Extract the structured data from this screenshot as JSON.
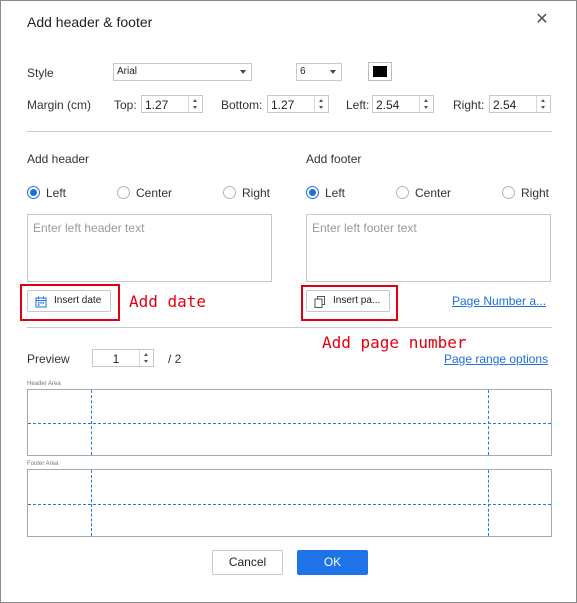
{
  "dialog": {
    "title": "Add header & footer"
  },
  "style": {
    "label": "Style",
    "font": "Arial",
    "size": "6",
    "color": "#000000"
  },
  "margin": {
    "label": "Margin (cm)",
    "top_label": "Top:",
    "top": "1.27",
    "bottom_label": "Bottom:",
    "bottom": "1.27",
    "left_label": "Left:",
    "left": "2.54",
    "right_label": "Right:",
    "right": "2.54"
  },
  "header": {
    "title": "Add header",
    "positions": [
      "Left",
      "Center",
      "Right"
    ],
    "selected": "Left",
    "placeholder": "Enter left header text",
    "insert_button": "Insert date",
    "annotation": "Add date"
  },
  "footer": {
    "title": "Add footer",
    "positions": [
      "Left",
      "Center",
      "Right"
    ],
    "selected": "Left",
    "placeholder": "Enter left footer text",
    "insert_button": "Insert pa...",
    "link": "Page Number a...",
    "annotation": "Add page number"
  },
  "preview": {
    "label": "Preview",
    "page": "1",
    "total": "/ 2",
    "range_link": "Page range options",
    "header_area_label": "Header Area",
    "footer_area_label": "Footer Area"
  },
  "buttons": {
    "cancel": "Cancel",
    "ok": "OK"
  },
  "colors": {
    "accent": "#1e73e8",
    "annotation": "#e1000f"
  }
}
